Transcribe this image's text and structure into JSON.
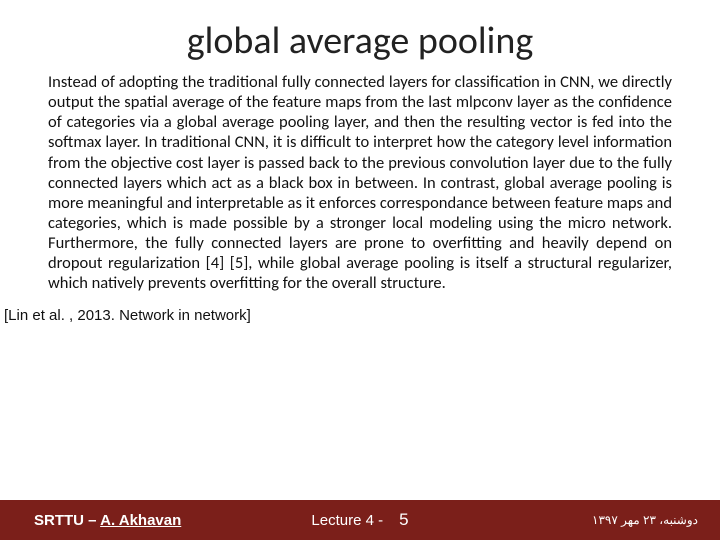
{
  "title": "global average pooling",
  "body": "Instead of adopting the traditional fully connected layers for classification in CNN, we directly output the spatial average of the feature maps from the last mlpconv layer as the confidence of categories via a global average pooling layer, and then the resulting vector is fed into the softmax layer. In traditional CNN, it is difficult to interpret how the category level information from the objective cost layer is passed back to the previous convolution layer due to the fully connected layers which act as a black box in between. In contrast, global average pooling is more meaningful and interpretable as it enforces correspondance between feature maps and categories, which is made possible by a stronger local modeling using the micro network. Furthermore, the fully connected layers are prone to overfitting and heavily depend on dropout regularization [4] [5], while global average pooling is itself a structural regularizer, which natively prevents overfitting for the overall structure.",
  "citation": "[Lin et al. , 2013. Network in network]",
  "footer": {
    "org": "SRTTU – ",
    "author": "A. Akhavan",
    "lecture": "Lecture 4 -",
    "page": "5",
    "date_fa": "دوشنبه، ۲۳ مهر ۱۳۹۷"
  }
}
